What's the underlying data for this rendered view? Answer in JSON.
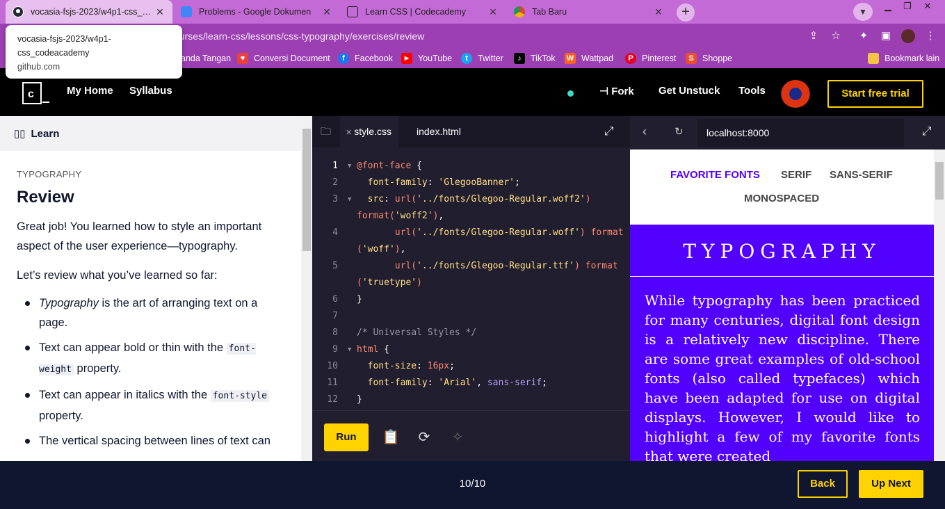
{
  "browser": {
    "tabs": [
      {
        "title": "vocasia-fsjs-2023/w4p1-css_code",
        "icon": "github-icon",
        "active": true
      },
      {
        "title": "Problems - Google Dokumen",
        "icon": "google-docs-icon",
        "active": false
      },
      {
        "title": "Learn CSS | Codecademy",
        "icon": "codecademy-icon",
        "active": false
      },
      {
        "title": "Tab Baru",
        "icon": "chrome-icon",
        "active": false
      }
    ],
    "url": "ourses/learn-css/lessons/css-typography/exercises/review",
    "bookmarks": [
      {
        "label": "anda Tangan",
        "icon": ""
      },
      {
        "label": "Conversi Document",
        "icon": "heart-icon"
      },
      {
        "label": "Facebook",
        "icon": "facebook-icon"
      },
      {
        "label": "YouTube",
        "icon": "youtube-icon"
      },
      {
        "label": "Twitter",
        "icon": "twitter-icon"
      },
      {
        "label": "TikTok",
        "icon": "tiktok-icon"
      },
      {
        "label": "Wattpad",
        "icon": "wattpad-icon"
      },
      {
        "label": "Pinterest",
        "icon": "pinterest-icon"
      },
      {
        "label": "Shoppe",
        "icon": "shopee-icon"
      },
      {
        "label": "Bookmark lain",
        "icon": "folder-icon"
      }
    ],
    "tooltip": {
      "line1": "vocasia-fsjs-2023/w4p1-",
      "line2": "css_codeacademy",
      "domain": "github.com"
    }
  },
  "header": {
    "nav": [
      "My Home",
      "Syllabus"
    ],
    "fork": "Fork",
    "get_unstuck": "Get Unstuck",
    "tools": "Tools",
    "trial": "Start free trial"
  },
  "learn": {
    "tab_label": "Learn",
    "eyebrow": "TYPOGRAPHY",
    "title": "Review",
    "intro": "Great job! You learned how to style an important aspect of the user experience—typography.",
    "lead": "Let’s review what you’ve learned so far:",
    "bullets": [
      {
        "em": "Typography",
        "text": " is the art of arranging text on a page."
      },
      {
        "pre": "Text can appear bold or thin with the ",
        "code": "font-weight",
        "post": " property."
      },
      {
        "pre": "Text can appear in italics with the ",
        "code": "font-style",
        "post": " property."
      },
      {
        "pre": "The vertical spacing between lines of text can",
        "code": "",
        "post": ""
      }
    ]
  },
  "editor": {
    "tabs": [
      "style.css",
      "index.html"
    ],
    "run": "Run",
    "lines": [
      {
        "n": "1",
        "fold": true,
        "tokens": [
          {
            "c": "kw",
            "t": "@font-face"
          },
          {
            "c": "",
            "t": " {"
          }
        ]
      },
      {
        "n": "2",
        "fold": false,
        "tokens": [
          {
            "c": "prop",
            "t": "  font-family"
          },
          {
            "c": "",
            "t": ": "
          },
          {
            "c": "str",
            "t": "'GlegooBanner'"
          },
          {
            "c": "",
            "t": ";"
          }
        ]
      },
      {
        "n": "3",
        "fold": true,
        "tokens": [
          {
            "c": "prop",
            "t": "  src"
          },
          {
            "c": "",
            "t": ": "
          },
          {
            "c": "val",
            "t": "url("
          },
          {
            "c": "str",
            "t": "'../fonts/Glegoo-Regular.woff2'"
          },
          {
            "c": "val",
            "t": ")"
          }
        ]
      },
      {
        "n": "",
        "fold": false,
        "tokens": [
          {
            "c": "val",
            "t": "format("
          },
          {
            "c": "str",
            "t": "'woff2'"
          },
          {
            "c": "val",
            "t": ")"
          },
          {
            "c": "",
            "t": ","
          }
        ]
      },
      {
        "n": "4",
        "fold": false,
        "tokens": [
          {
            "c": "",
            "t": "       "
          },
          {
            "c": "val",
            "t": "url("
          },
          {
            "c": "str",
            "t": "'../fonts/Glegoo-Regular.woff'"
          },
          {
            "c": "val",
            "t": ") format"
          }
        ]
      },
      {
        "n": "",
        "fold": false,
        "tokens": [
          {
            "c": "val",
            "t": "("
          },
          {
            "c": "str",
            "t": "'woff'"
          },
          {
            "c": "val",
            "t": ")"
          },
          {
            "c": "",
            "t": ","
          }
        ]
      },
      {
        "n": "5",
        "fold": false,
        "tokens": [
          {
            "c": "",
            "t": "       "
          },
          {
            "c": "val",
            "t": "url("
          },
          {
            "c": "str",
            "t": "'../fonts/Glegoo-Regular.ttf'"
          },
          {
            "c": "val",
            "t": ") format"
          }
        ]
      },
      {
        "n": "",
        "fold": false,
        "tokens": [
          {
            "c": "val",
            "t": "("
          },
          {
            "c": "str",
            "t": "'truetype'"
          },
          {
            "c": "val",
            "t": ")"
          }
        ]
      },
      {
        "n": "6",
        "fold": false,
        "tokens": [
          {
            "c": "",
            "t": "}"
          }
        ]
      },
      {
        "n": "7",
        "fold": false,
        "tokens": []
      },
      {
        "n": "8",
        "fold": false,
        "tokens": [
          {
            "c": "cmt",
            "t": "/* Universal Styles */"
          }
        ]
      },
      {
        "n": "9",
        "fold": true,
        "tokens": [
          {
            "c": "kw",
            "t": "html"
          },
          {
            "c": "",
            "t": " {"
          }
        ]
      },
      {
        "n": "10",
        "fold": false,
        "tokens": [
          {
            "c": "prop",
            "t": "  font-size"
          },
          {
            "c": "",
            "t": ": "
          },
          {
            "c": "val",
            "t": "16px"
          },
          {
            "c": "",
            "t": ";"
          }
        ]
      },
      {
        "n": "11",
        "fold": false,
        "tokens": [
          {
            "c": "prop",
            "t": "  font-family"
          },
          {
            "c": "",
            "t": ": "
          },
          {
            "c": "str",
            "t": "'Arial'"
          },
          {
            "c": "",
            "t": ", "
          },
          {
            "c": "purp",
            "t": "sans-serif"
          },
          {
            "c": "",
            "t": ";"
          }
        ]
      },
      {
        "n": "12",
        "fold": false,
        "tokens": [
          {
            "c": "",
            "t": "}"
          }
        ]
      }
    ]
  },
  "preview": {
    "url": "localhost:8000",
    "nav": [
      "FAVORITE FONTS",
      "SERIF",
      "SANS-SERIF",
      "MONOSPACED"
    ],
    "hero": "TYPOGRAPHY",
    "body": "While typography has been practiced for many centuries, digital font design is a relatively new discipline. There are some great examples of old-school fonts (also called typefaces) which have been adapted for use on digital displays. However, I would like to highlight a few of my favorite fonts that were created"
  },
  "footer": {
    "counter": "10/10",
    "back": "Back",
    "next": "Up Next"
  },
  "colors": {
    "accent": "#ffd300",
    "preview_bg": "#5200ff",
    "chrome": "#c46ad6",
    "toolbar": "#9c3fb3"
  }
}
